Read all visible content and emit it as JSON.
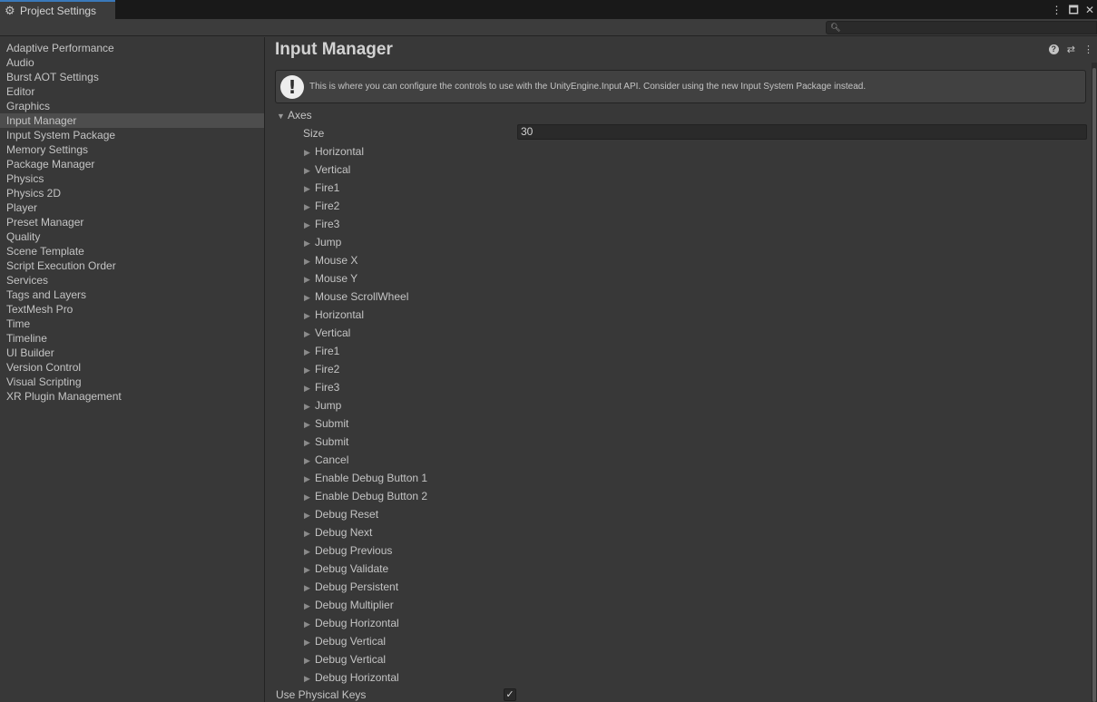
{
  "window": {
    "tab_title": "Project Settings",
    "tab_icon": "gear-icon"
  },
  "search": {
    "placeholder": ""
  },
  "sidebar": {
    "items": [
      {
        "label": "Adaptive Performance"
      },
      {
        "label": "Audio"
      },
      {
        "label": "Burst AOT Settings"
      },
      {
        "label": "Editor"
      },
      {
        "label": "Graphics"
      },
      {
        "label": "Input Manager",
        "selected": true
      },
      {
        "label": "Input System Package"
      },
      {
        "label": "Memory Settings"
      },
      {
        "label": "Package Manager"
      },
      {
        "label": "Physics"
      },
      {
        "label": "Physics 2D"
      },
      {
        "label": "Player"
      },
      {
        "label": "Preset Manager"
      },
      {
        "label": "Quality"
      },
      {
        "label": "Scene Template"
      },
      {
        "label": "Script Execution Order"
      },
      {
        "label": "Services"
      },
      {
        "label": "Tags and Layers"
      },
      {
        "label": "TextMesh Pro"
      },
      {
        "label": "Time"
      },
      {
        "label": "Timeline"
      },
      {
        "label": "UI Builder"
      },
      {
        "label": "Version Control"
      },
      {
        "label": "Visual Scripting"
      },
      {
        "label": "XR Plugin Management"
      }
    ]
  },
  "main": {
    "title": "Input Manager",
    "help_text": "This is where you can configure the controls to use with the UnityEngine.Input API. Consider using the new Input System Package instead.",
    "axes_label": "Axes",
    "size_label": "Size",
    "size_value": "30",
    "axes": [
      "Horizontal",
      "Vertical",
      "Fire1",
      "Fire2",
      "Fire3",
      "Jump",
      "Mouse X",
      "Mouse Y",
      "Mouse ScrollWheel",
      "Horizontal",
      "Vertical",
      "Fire1",
      "Fire2",
      "Fire3",
      "Jump",
      "Submit",
      "Submit",
      "Cancel",
      "Enable Debug Button 1",
      "Enable Debug Button 2",
      "Debug Reset",
      "Debug Next",
      "Debug Previous",
      "Debug Validate",
      "Debug Persistent",
      "Debug Multiplier",
      "Debug Horizontal",
      "Debug Vertical",
      "Debug Vertical",
      "Debug Horizontal"
    ],
    "use_physical_keys_label": "Use Physical Keys",
    "use_physical_keys_checked": true
  },
  "colors": {
    "accent": "#3a79bb",
    "background": "#383838",
    "selected_item": "#4d4d4d"
  }
}
